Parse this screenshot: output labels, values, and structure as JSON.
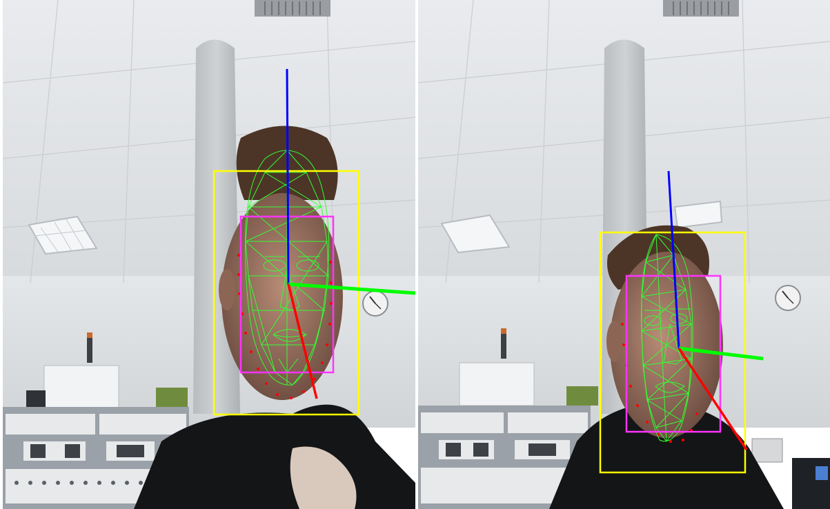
{
  "image": {
    "description_free": true,
    "panels": [
      {
        "id": "left",
        "overlays": {
          "face_box_color": "#ffff00",
          "inner_box_color": "#ff33ff",
          "mesh_color": "#33ff33",
          "landmark_color": "#ff0000",
          "axis_colors": {
            "x": "#00ff00",
            "y": "#ff0000",
            "z": "#0000ff"
          }
        }
      },
      {
        "id": "right",
        "overlays": {
          "face_box_color": "#ffff00",
          "inner_box_color": "#ff33ff",
          "mesh_color": "#33ff33",
          "landmark_color": "#ff0000",
          "axis_colors": {
            "x": "#00ff00",
            "y": "#ff0000",
            "z": "#0000ff"
          }
        }
      }
    ]
  }
}
